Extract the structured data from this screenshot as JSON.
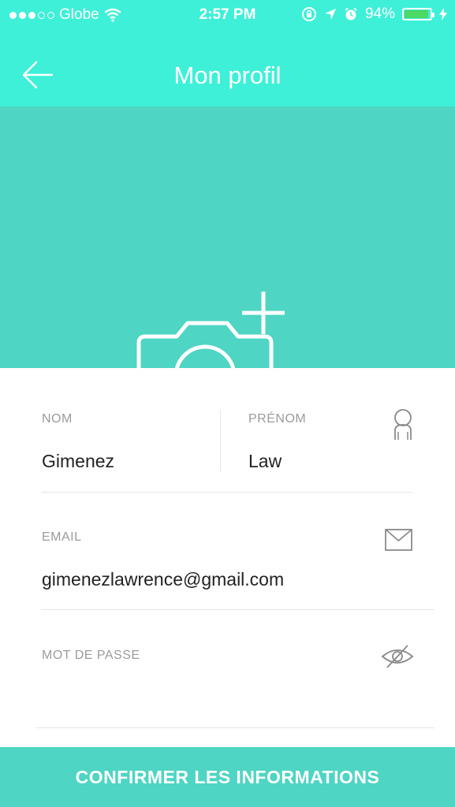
{
  "status_bar": {
    "carrier": "Globe",
    "time": "2:57 PM",
    "battery_percent": "94%",
    "battery_level": 0.94,
    "signal_bars_filled": 3,
    "signal_bars_total": 5
  },
  "header": {
    "title": "Mon profil",
    "back_icon": "arrow-left-icon",
    "background": "#3ef0d8"
  },
  "photo": {
    "background": "#4ed5c3",
    "main_icon": "camera-add-icon",
    "small_icon": "camera-add-small-icon"
  },
  "form": {
    "nom": {
      "label": "NOM",
      "value": "Gimenez"
    },
    "prenom": {
      "label": "PRÉNOM",
      "value": "Law",
      "icon": "user-icon"
    },
    "email": {
      "label": "EMAIL",
      "value": "gimenezlawrence@gmail.com",
      "icon": "envelope-icon"
    },
    "password": {
      "label": "MOT DE PASSE",
      "value": "",
      "icon": "eye-off-icon"
    }
  },
  "confirm_button": {
    "label": "CONFIRMER LES INFORMATIONS",
    "background": "#4ed5c3"
  }
}
